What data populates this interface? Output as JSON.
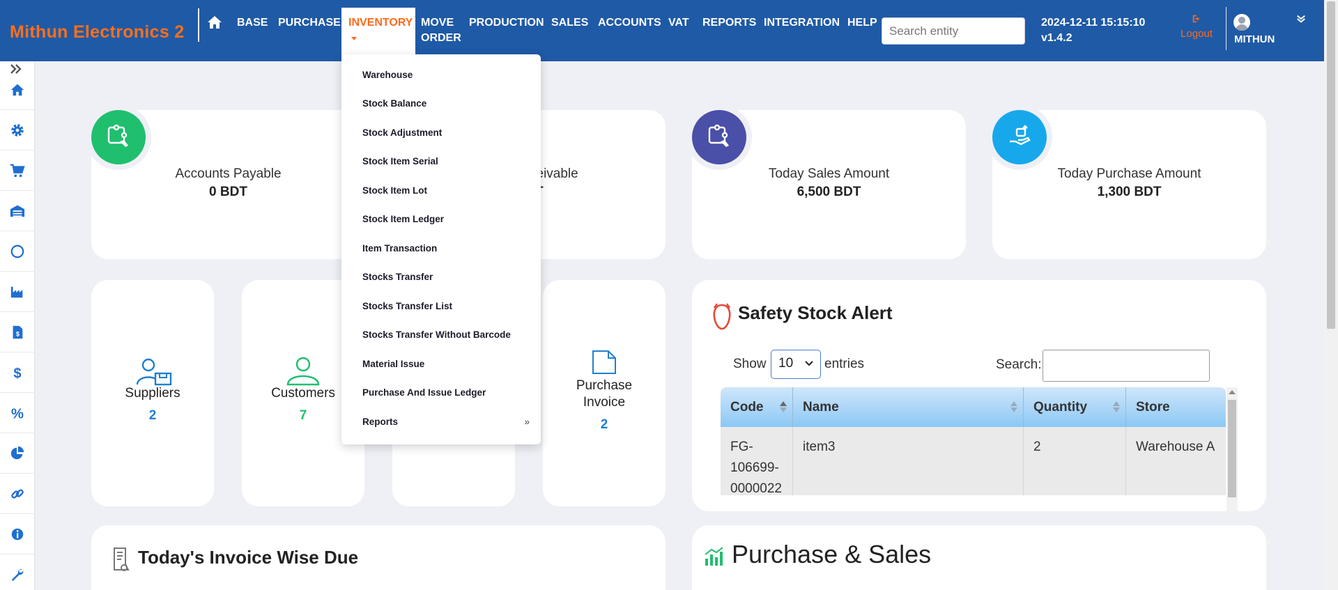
{
  "brand": "Mithun Electronics 2",
  "nav": {
    "home_icon": "home-icon",
    "items": [
      "BASE",
      "PURCHASE",
      "INVENTORY",
      "MOVE",
      "ORDER",
      "PRODUCTION",
      "SALES",
      "ACCOUNTS",
      "VAT",
      "REPORTS",
      "INTEGRATION",
      "HELP"
    ],
    "active": "INVENTORY"
  },
  "search": {
    "placeholder": "Search entity"
  },
  "clock": {
    "datetime": "2024-12-11 15:15:10",
    "version": "v1.4.2"
  },
  "logout": "Logout",
  "user": {
    "name": "MITHUN"
  },
  "sidebar": {
    "icons": [
      "home-icon",
      "gear-icon",
      "cart-icon",
      "warehouse-icon",
      "circle-icon",
      "factory-icon",
      "invoice-icon",
      "dollar-icon",
      "percent-icon",
      "pie-chart-icon",
      "link-icon",
      "info-icon",
      "wrench-icon"
    ]
  },
  "inventory_menu": {
    "items": [
      "Warehouse",
      "Stock Balance",
      "Stock Adjustment",
      "Stock Item Serial",
      "Stock Item Lot",
      "Stock Item Ledger",
      "Item Transaction",
      "Stocks Transfer",
      "Stocks Transfer List",
      "Stocks Transfer Without Barcode",
      "Material Issue",
      "Purchase And Issue Ledger",
      "Reports"
    ],
    "submenu_arrow": "»"
  },
  "stats": {
    "accounts_payable": {
      "label": "Accounts Payable",
      "value": "0 BDT"
    },
    "accounts_receivable": {
      "label": "ceivable",
      "value": "T"
    },
    "today_sales": {
      "label": "Today Sales Amount",
      "value": "6,500 BDT"
    },
    "today_purchase": {
      "label": "Today Purchase Amount",
      "value": "1,300 BDT"
    }
  },
  "counts": {
    "suppliers": {
      "label": "Suppliers",
      "value": "2"
    },
    "customers": {
      "label": "Customers",
      "value": "7"
    },
    "purchase_invoice": {
      "label_line1": "Purchase",
      "label_line2": "Invoice",
      "value": "2"
    }
  },
  "safety_stock": {
    "title": "Safety Stock Alert",
    "show_label": "Show",
    "page_size": "10",
    "entries_label": "entries",
    "search_label": "Search:",
    "columns": [
      "Code",
      "Name",
      "Quantity",
      "Store"
    ],
    "rows": [
      {
        "code_lines": [
          "FG-",
          "106699-",
          "0000022"
        ],
        "name": "item3",
        "quantity": "2",
        "store": "Warehouse A"
      }
    ]
  },
  "sections": {
    "invoice_due_title": "Today's Invoice Wise Due",
    "purchase_sales_title": "Purchase & Sales"
  },
  "colors": {
    "nav_bg": "#1f5aa6",
    "brand_orange": "#ff6f1a",
    "green": "#1fbf6e",
    "indigo": "#4a4fa8",
    "sky": "#17a8ec",
    "count_blue": "#1f7fd0",
    "count_green": "#1fbf6e"
  }
}
